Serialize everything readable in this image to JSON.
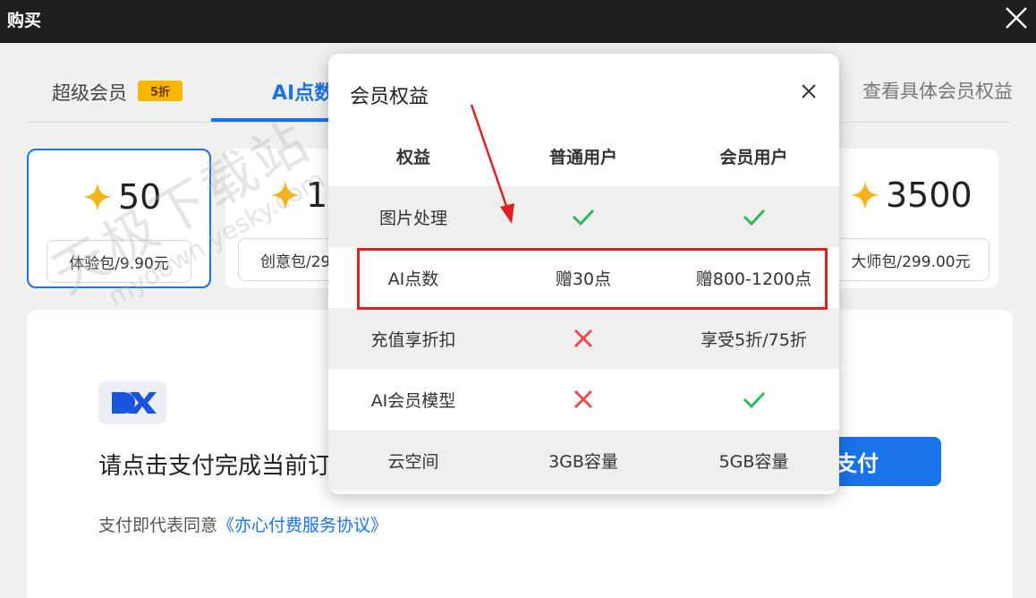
{
  "window": {
    "title": "购买"
  },
  "tabs": {
    "super_member": "超级会员",
    "super_badge": "5折",
    "ai_points": "AI点数",
    "view_benefits": "查看具体会员权益"
  },
  "packages": [
    {
      "amount": "50",
      "label": "体验包/9.90元"
    },
    {
      "amount": "1",
      "label": "创意包/29"
    },
    {
      "amount": "3500",
      "label": "大师包/299.00元"
    }
  ],
  "payment": {
    "prompt": "请点击支付完成当前订",
    "button": "支付",
    "agree_prefix": "支付即代表同意",
    "agree_link": "《亦心付费服务协议》"
  },
  "watermark": {
    "line1": "天极下载站",
    "line2": "mydown.yesky.com"
  },
  "modal": {
    "title": "会员权益",
    "headers": [
      "权益",
      "普通用户",
      "会员用户"
    ],
    "rows": [
      {
        "name": "图片处理",
        "normal": "check-icon",
        "member": "check-icon"
      },
      {
        "name": "AI点数",
        "normal": "赠30点",
        "member": "赠800-1200点"
      },
      {
        "name": "充值享折扣",
        "normal": "cross-icon",
        "member": "享受5折/75折"
      },
      {
        "name": "AI会员模型",
        "normal": "cross-icon",
        "member": "check-icon"
      },
      {
        "name": "云空间",
        "normal": "3GB容量",
        "member": "5GB容量"
      }
    ]
  },
  "colors": {
    "accent": "#1a73e8",
    "badge": "#f9b600",
    "check": "#2bbb5a",
    "cross": "#ef4d4d",
    "annotation": "#e02020"
  }
}
